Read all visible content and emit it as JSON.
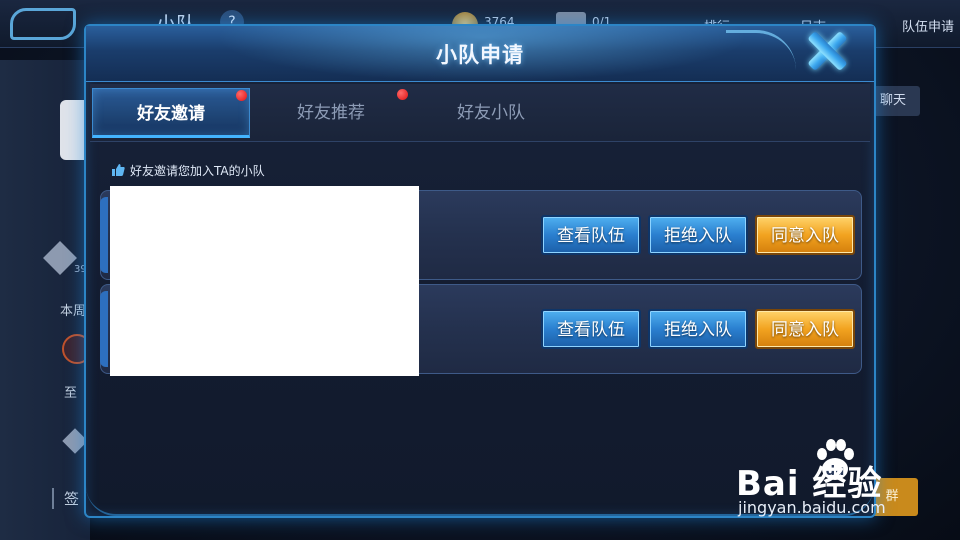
{
  "background": {
    "title": "小队",
    "help": "?",
    "coin_value": "3764",
    "ticket_value": "0/1",
    "nav_items": [
      "排行",
      "日志"
    ],
    "team_apply": "队伍申请",
    "chat": "聊天",
    "level": "39",
    "text1": "本周",
    "text2": "至",
    "text3": "签",
    "orange_btn": "群"
  },
  "modal": {
    "title": "小队申请",
    "tabs": [
      {
        "label": "好友邀请",
        "active": true,
        "badge": true
      },
      {
        "label": "好友推荐",
        "active": false,
        "badge": true
      },
      {
        "label": "好友小队",
        "active": false,
        "badge": false
      }
    ],
    "subtitle": "好友邀请您加入TA的小队",
    "invites": [
      {
        "view_label": "查看队伍",
        "reject_label": "拒绝入队",
        "accept_label": "同意入队"
      },
      {
        "view_label": "查看队伍",
        "reject_label": "拒绝入队",
        "accept_label": "同意入队"
      }
    ]
  },
  "watermark": {
    "brand": "Bai  经验",
    "url": "jingyan.baidu.com"
  },
  "colors": {
    "accent_blue": "#2c85c6",
    "button_blue": "#2a7fcf",
    "button_orange": "#f2a320",
    "badge_red": "#e01010"
  }
}
